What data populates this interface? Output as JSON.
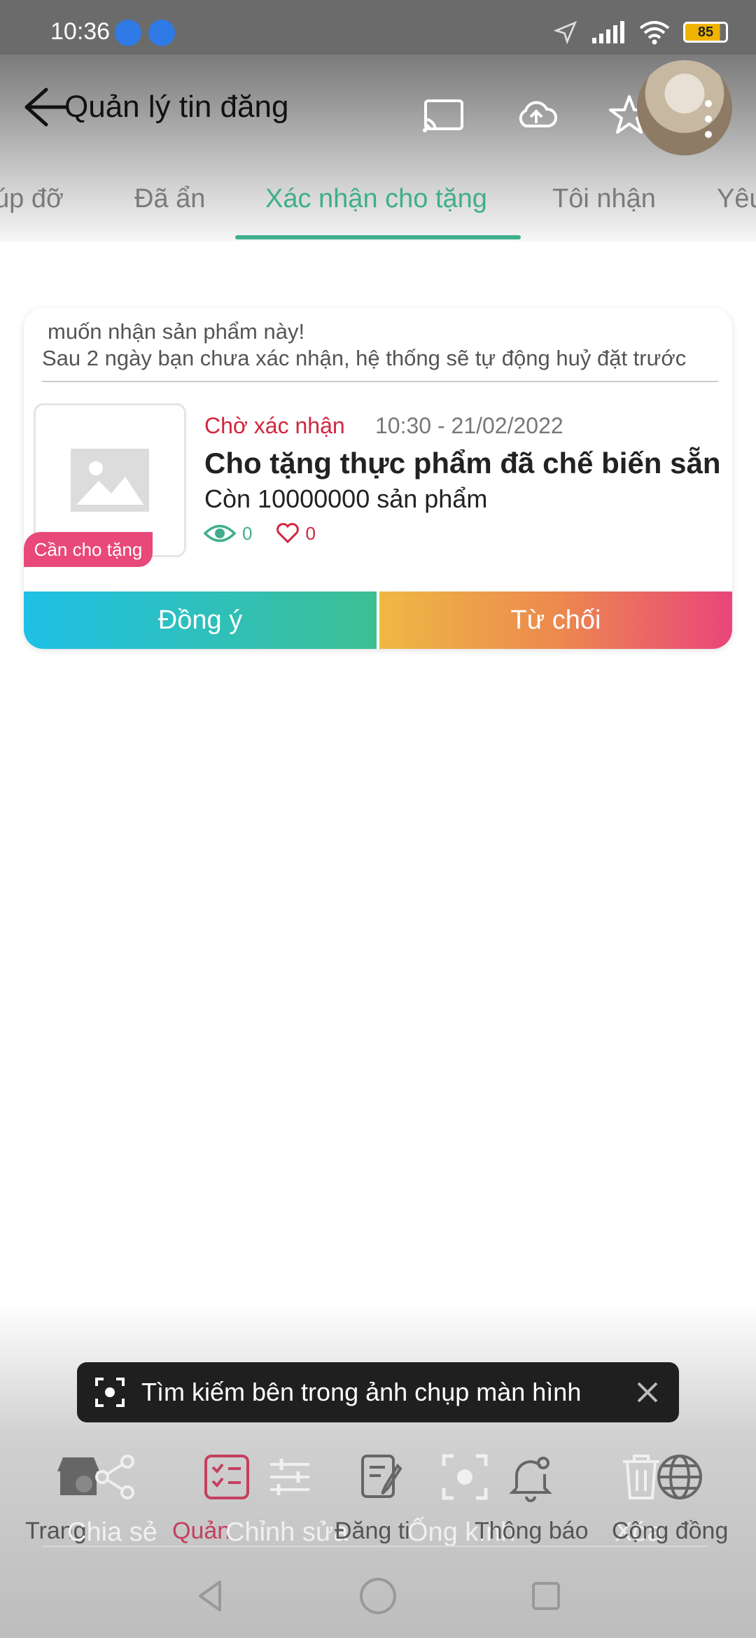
{
  "status_bar": {
    "time": "10:36",
    "battery": "85"
  },
  "header": {
    "title": "Quản lý tin đăng"
  },
  "tabs": [
    {
      "label": "úp đỡ"
    },
    {
      "label": "Đã ẩn"
    },
    {
      "label": "Xác nhận cho tặng"
    },
    {
      "label": "Tôi nhận"
    },
    {
      "label": "Yêu"
    }
  ],
  "card": {
    "notice_line1": "muốn nhận sản phẩm này!",
    "notice_line2": "Sau 2 ngày bạn chưa xác nhận, hệ thống sẽ tự động huỷ đặt trước",
    "badge": "Cần cho tặng",
    "status": "Chờ xác nhận",
    "datetime": "10:30 - 21/02/2022",
    "title": "Cho tặng thực phẩm đã chế biến sẵn",
    "remaining": "Còn 10000000 sản phẩm",
    "views": "0",
    "likes": "0",
    "agree_label": "Đồng ý",
    "reject_label": "Từ chối"
  },
  "toast": {
    "text": "Tìm kiếm bên trong ảnh chụp màn hình"
  },
  "bottom_nav": {
    "labels": [
      "Trang",
      "Chia sẻ",
      "Quản",
      "Chỉnh sửa",
      "Đăng ti",
      "Ống kính",
      "Thông báo",
      "Xóa",
      "Cộng đồng"
    ]
  },
  "colors": {
    "accent": "#3fae8c",
    "status_red": "#d2263d",
    "badge_pink": "#e8497a",
    "agree_gradient": [
      "#1ec0e6",
      "#3dbf93"
    ],
    "reject_gradient": [
      "#eeb844",
      "#e9457a"
    ]
  }
}
